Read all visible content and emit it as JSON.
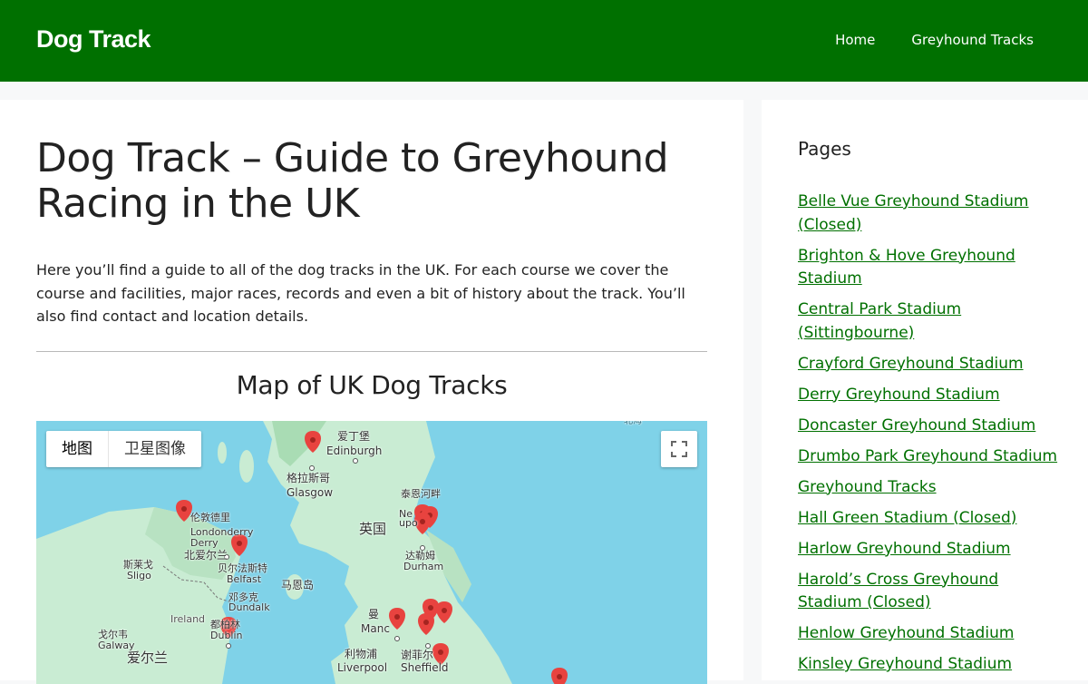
{
  "header": {
    "site_title": "Dog Track",
    "nav": [
      {
        "label": "Home"
      },
      {
        "label": "Greyhound Tracks"
      }
    ]
  },
  "main": {
    "title": "Dog Track – Guide to Greyhound Racing in the UK",
    "intro": "Here you’ll find a guide to all of the dog tracks in the UK. For each course we cover the course and facilities, major races, records and even a bit of history about the track. You’ll also find contact and location details.",
    "map_heading": "Map of UK Dog Tracks"
  },
  "map": {
    "type_buttons": [
      "地图",
      "卫星图像"
    ],
    "labels": {
      "aiding": "爱丁堡",
      "edinburgh": "Edinburgh",
      "glasgow_cn": "格拉斯哥",
      "glasgow": "Glasgow",
      "uk_cn": "英国",
      "newcastle_cn": "泰恩河畔",
      "newcastle_en": "Ne",
      "newcastle_en2": "upo",
      "durham_cn": "达勒姆",
      "durham": "Durham",
      "londonderry_cn": "伦敦德里",
      "londonderry": "Londonderry",
      "derry": "Derry",
      "ni_cn": "北爱尔兰",
      "belfast_cn": "贝尔法斯特",
      "belfast": "Belfast",
      "sligo_cn": "斯莱戈",
      "sligo": "Sligo",
      "dundalk_cn": "邓多克",
      "dundalk": "Dundalk",
      "isle_of_man_cn": "马恩岛",
      "ireland": "Ireland",
      "dublin_cn": "都柏林",
      "dublin": "Dublin",
      "galway_cn": "戈尔韦",
      "galway": "Galway",
      "ireland_cn": "爱尔兰",
      "manchester_cn": "曼",
      "manchester": "Manc",
      "liverpool_cn": "利物浦",
      "liverpool": "Liverpool",
      "sheffield_cn": "谢菲尔",
      "sheffield": "Sheffield",
      "north_sea": "北海"
    },
    "colors": {
      "water": "#7fd2e8",
      "land": "#c9ecd3",
      "land_dark": "#a9dcb4",
      "marker": "#e8433f"
    }
  },
  "sidebar": {
    "title": "Pages",
    "pages": [
      "Belle Vue Greyhound Stadium (Closed)",
      "Brighton & Hove Greyhound Stadium",
      "Central Park Stadium (Sittingbourne)",
      "Crayford Greyhound Stadium",
      "Derry Greyhound Stadium",
      "Doncaster Greyhound Stadium",
      "Drumbo Park Greyhound Stadium",
      "Greyhound Tracks",
      "Hall Green Stadium (Closed)",
      "Harlow Greyhound Stadium",
      "Harold’s Cross Greyhound Stadium (Closed)",
      "Henlow Greyhound Stadium",
      "Kinsley Greyhound Stadium"
    ]
  }
}
